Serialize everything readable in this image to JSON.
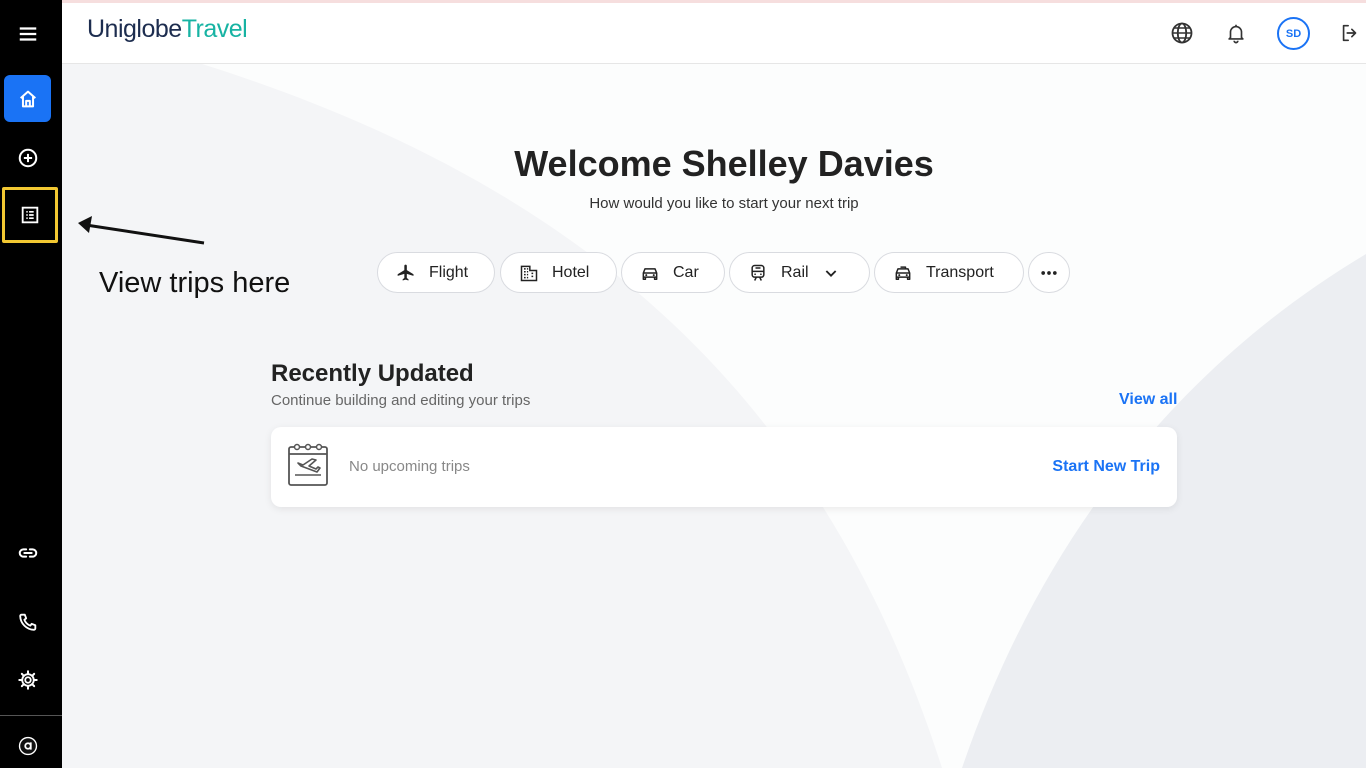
{
  "brand": {
    "part1": "Uniglobe",
    "part2": "Travel"
  },
  "header": {
    "avatar_initials": "SD"
  },
  "sidebar": {
    "items": [
      {
        "icon": "menu-icon"
      },
      {
        "icon": "home-icon"
      },
      {
        "icon": "add-circle-icon"
      },
      {
        "icon": "trips-list-icon"
      },
      {
        "icon": "link-icon"
      },
      {
        "icon": "phone-icon"
      },
      {
        "icon": "gear-icon"
      },
      {
        "icon": "app-logo-icon"
      }
    ]
  },
  "main": {
    "welcome": "Welcome Shelley Davies",
    "subtitle": "How would you like to start your next trip",
    "booking_options": {
      "flight": "Flight",
      "hotel": "Hotel",
      "car": "Car",
      "rail": "Rail",
      "transport": "Transport"
    },
    "annotation": "View trips here",
    "recent": {
      "title": "Recently Updated",
      "subtitle": "Continue building and editing your trips",
      "view_all": "View all",
      "empty_text": "No upcoming trips",
      "start_new": "Start New Trip"
    }
  },
  "colors": {
    "accent": "#1a73f5",
    "sidebar_bg": "#000000",
    "highlight": "#f2c832",
    "brand_teal": "#17b3a3"
  }
}
